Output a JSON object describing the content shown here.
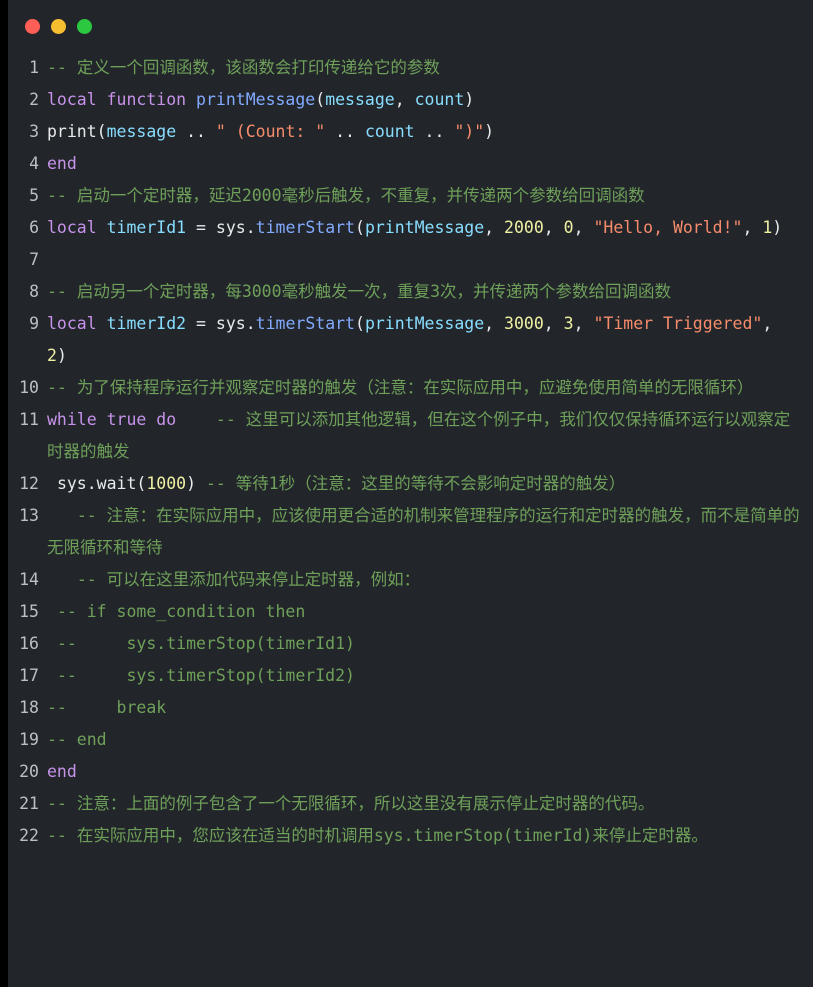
{
  "window": {
    "background_color": "#22262a",
    "controls": [
      {
        "name": "close-button",
        "color": "#ff5f57",
        "label": ""
      },
      {
        "name": "minimize-button",
        "color": "#f6bd30",
        "label": ""
      },
      {
        "name": "maximize-button",
        "color": "#2bc840",
        "label": ""
      }
    ]
  },
  "editor": {
    "language": "lua",
    "theme_colors": {
      "background": "#22262a",
      "line_number": "#b9c0c6",
      "keyword": "#c792ea",
      "function": "#82aaff",
      "variable": "#89ddff",
      "string": "#f78c6c",
      "number": "#eff0a3",
      "comment": "#6fa05a",
      "plain": "#e8eaed"
    },
    "lines": [
      {
        "n": "1",
        "text": "-- 定义一个回调函数，该函数会打印传递给它的参数"
      },
      {
        "n": "2",
        "text": "local function printMessage(message, count)"
      },
      {
        "n": "3",
        "text": "print(message .. \" (Count: \" .. count .. \")\")"
      },
      {
        "n": "4",
        "text": "end"
      },
      {
        "n": "5",
        "text": "-- 启动一个定时器，延迟2000毫秒后触发，不重复，并传递两个参数给回调函数"
      },
      {
        "n": "6",
        "text": "local timerId1 = sys.timerStart(printMessage, 2000, 0, \"Hello, World!\", 1)"
      },
      {
        "n": "7",
        "text": ""
      },
      {
        "n": "8",
        "text": "-- 启动另一个定时器，每3000毫秒触发一次，重复3次，并传递两个参数给回调函数"
      },
      {
        "n": "9",
        "text": "local timerId2 = sys.timerStart(printMessage, 3000, 3, \"Timer Triggered\", 2)"
      },
      {
        "n": "10",
        "text": "-- 为了保持程序运行并观察定时器的触发（注意：在实际应用中，应避免使用简单的无限循环）"
      },
      {
        "n": "11",
        "text": "while true do    -- 这里可以添加其他逻辑，但在这个例子中，我们仅仅保持循环运行以观察定时器的触发"
      },
      {
        "n": "12",
        "text": " sys.wait(1000) -- 等待1秒（注意：这里的等待不会影响定时器的触发）"
      },
      {
        "n": "13",
        "text": "   -- 注意：在实际应用中，应该使用更合适的机制来管理程序的运行和定时器的触发，而不是简单的无限循环和等待"
      },
      {
        "n": "14",
        "text": "   -- 可以在这里添加代码来停止定时器，例如："
      },
      {
        "n": "15",
        "text": " -- if some_condition then"
      },
      {
        "n": "16",
        "text": " --     sys.timerStop(timerId1)"
      },
      {
        "n": "17",
        "text": " --     sys.timerStop(timerId2)"
      },
      {
        "n": "18",
        "text": "--     break"
      },
      {
        "n": "19",
        "text": "-- end"
      },
      {
        "n": "20",
        "text": "end"
      },
      {
        "n": "21",
        "text": "-- 注意：上面的例子包含了一个无限循环，所以这里没有展示停止定时器的代码。"
      },
      {
        "n": "22",
        "text": "-- 在实际应用中，您应该在适当的时机调用sys.timerStop(timerId)来停止定时器。"
      }
    ],
    "tokens": [
      {
        "n": "1",
        "parts": [
          {
            "c": "com",
            "t": "-- "
          },
          {
            "c": "com cjk",
            "t": "定义一个回调函数，该函数会打印传递给它的参数"
          }
        ]
      },
      {
        "n": "2",
        "parts": [
          {
            "c": "kw",
            "t": "local "
          },
          {
            "c": "kw",
            "t": "function"
          },
          {
            "c": "plain",
            "t": " "
          },
          {
            "c": "fn",
            "t": "printMessage"
          },
          {
            "c": "plain",
            "t": "("
          },
          {
            "c": "var",
            "t": "message"
          },
          {
            "c": "plain",
            "t": ", "
          },
          {
            "c": "var",
            "t": "count"
          },
          {
            "c": "plain",
            "t": ")"
          }
        ]
      },
      {
        "n": "3",
        "parts": [
          {
            "c": "plain",
            "t": "print("
          },
          {
            "c": "var",
            "t": "message"
          },
          {
            "c": "plain",
            "t": " .. "
          },
          {
            "c": "str",
            "t": "\" (Count: \""
          },
          {
            "c": "plain",
            "t": " .. "
          },
          {
            "c": "var",
            "t": "count"
          },
          {
            "c": "plain",
            "t": " .. "
          },
          {
            "c": "str",
            "t": "\")\""
          },
          {
            "c": "plain",
            "t": ")"
          }
        ]
      },
      {
        "n": "4",
        "parts": [
          {
            "c": "kw",
            "t": "end"
          }
        ]
      },
      {
        "n": "5",
        "parts": [
          {
            "c": "com",
            "t": "-- "
          },
          {
            "c": "com cjk",
            "t": "启动一个定时器，延迟"
          },
          {
            "c": "com",
            "t": "2000"
          },
          {
            "c": "com cjk",
            "t": "毫秒后触发，不重复，并传递两个参数给回调函数"
          }
        ]
      },
      {
        "n": "6",
        "parts": [
          {
            "c": "kw",
            "t": "local "
          },
          {
            "c": "var",
            "t": "timerId1"
          },
          {
            "c": "plain",
            "t": " = "
          },
          {
            "c": "plain",
            "t": "sys."
          },
          {
            "c": "fn",
            "t": "timerStart"
          },
          {
            "c": "plain",
            "t": "("
          },
          {
            "c": "var",
            "t": "printMessage"
          },
          {
            "c": "plain",
            "t": ", "
          },
          {
            "c": "num",
            "t": "2000"
          },
          {
            "c": "plain",
            "t": ", "
          },
          {
            "c": "num",
            "t": "0"
          },
          {
            "c": "plain",
            "t": ", "
          },
          {
            "c": "str",
            "t": "\"Hello, World!\""
          },
          {
            "c": "plain",
            "t": ", "
          },
          {
            "c": "num",
            "t": "1"
          },
          {
            "c": "plain",
            "t": ")"
          }
        ]
      },
      {
        "n": "7",
        "parts": []
      },
      {
        "n": "8",
        "parts": [
          {
            "c": "com",
            "t": "-- "
          },
          {
            "c": "com cjk",
            "t": "启动另一个定时器，每"
          },
          {
            "c": "com",
            "t": "3000"
          },
          {
            "c": "com cjk",
            "t": "毫秒触发一次，重复"
          },
          {
            "c": "com",
            "t": "3"
          },
          {
            "c": "com cjk",
            "t": "次，并传递两个参数给回调函数"
          }
        ]
      },
      {
        "n": "9",
        "parts": [
          {
            "c": "kw",
            "t": "local "
          },
          {
            "c": "var",
            "t": "timerId2"
          },
          {
            "c": "plain",
            "t": " = "
          },
          {
            "c": "plain",
            "t": "sys."
          },
          {
            "c": "fn",
            "t": "timerStart"
          },
          {
            "c": "plain",
            "t": "("
          },
          {
            "c": "var",
            "t": "printMessage"
          },
          {
            "c": "plain",
            "t": ", "
          },
          {
            "c": "num",
            "t": "3000"
          },
          {
            "c": "plain",
            "t": ", "
          },
          {
            "c": "num",
            "t": "3"
          },
          {
            "c": "plain",
            "t": ", "
          },
          {
            "c": "str",
            "t": "\"Timer Triggered\""
          },
          {
            "c": "plain",
            "t": ", "
          },
          {
            "c": "num",
            "t": "2"
          },
          {
            "c": "plain",
            "t": ")"
          }
        ]
      },
      {
        "n": "10",
        "parts": [
          {
            "c": "com",
            "t": "-- "
          },
          {
            "c": "com cjk",
            "t": "为了保持程序运行并观察定时器的触发（注意：在实际应用中，应避免使用简单的无限循环）"
          }
        ]
      },
      {
        "n": "11",
        "parts": [
          {
            "c": "kw",
            "t": "while"
          },
          {
            "c": "plain",
            "t": " "
          },
          {
            "c": "kw",
            "t": "true"
          },
          {
            "c": "plain",
            "t": " "
          },
          {
            "c": "kw",
            "t": "do"
          },
          {
            "c": "plain",
            "t": "    "
          },
          {
            "c": "com",
            "t": "-- "
          },
          {
            "c": "com cjk",
            "t": "这里可以添加其他逻辑，但在这个例子中，我们仅仅保持循环运行以观察定时器的触发"
          }
        ]
      },
      {
        "n": "12",
        "parts": [
          {
            "c": "plain",
            "t": " sys.wait("
          },
          {
            "c": "num",
            "t": "1000"
          },
          {
            "c": "plain",
            "t": ") "
          },
          {
            "c": "com",
            "t": "-- "
          },
          {
            "c": "com cjk",
            "t": "等待"
          },
          {
            "c": "com",
            "t": "1"
          },
          {
            "c": "com cjk",
            "t": "秒（注意：这里的等待不会影响定时器的触发）"
          }
        ]
      },
      {
        "n": "13",
        "parts": [
          {
            "c": "plain",
            "t": "   "
          },
          {
            "c": "com",
            "t": "-- "
          },
          {
            "c": "com cjk",
            "t": "注意：在实际应用中，应该使用更合适的机制来管理程序的运行和定时器的触发，而不是简单的无限循环和等待"
          }
        ]
      },
      {
        "n": "14",
        "parts": [
          {
            "c": "plain",
            "t": "   "
          },
          {
            "c": "com",
            "t": "-- "
          },
          {
            "c": "com cjk",
            "t": "可以在这里添加代码来停止定时器，例如："
          }
        ]
      },
      {
        "n": "15",
        "parts": [
          {
            "c": "plain",
            "t": " "
          },
          {
            "c": "com",
            "t": "-- if some_condition then"
          }
        ]
      },
      {
        "n": "16",
        "parts": [
          {
            "c": "plain",
            "t": " "
          },
          {
            "c": "com",
            "t": "--     sys.timerStop(timerId1)"
          }
        ]
      },
      {
        "n": "17",
        "parts": [
          {
            "c": "plain",
            "t": " "
          },
          {
            "c": "com",
            "t": "--     sys.timerStop(timerId2)"
          }
        ]
      },
      {
        "n": "18",
        "parts": [
          {
            "c": "com",
            "t": "--     break"
          }
        ]
      },
      {
        "n": "19",
        "parts": [
          {
            "c": "com",
            "t": "-- end"
          }
        ]
      },
      {
        "n": "20",
        "parts": [
          {
            "c": "kw",
            "t": "end"
          }
        ]
      },
      {
        "n": "21",
        "parts": [
          {
            "c": "com",
            "t": "-- "
          },
          {
            "c": "com cjk",
            "t": "注意：上面的例子包含了一个无限循环，所以这里没有展示停止定时器的代码。"
          }
        ]
      },
      {
        "n": "22",
        "parts": [
          {
            "c": "com",
            "t": "-- "
          },
          {
            "c": "com cjk",
            "t": "在实际应用中，您应该在适当的时机调用"
          },
          {
            "c": "com",
            "t": "sys.timerStop(timerId)"
          },
          {
            "c": "com cjk",
            "t": "来停止定时器。"
          }
        ]
      }
    ]
  }
}
